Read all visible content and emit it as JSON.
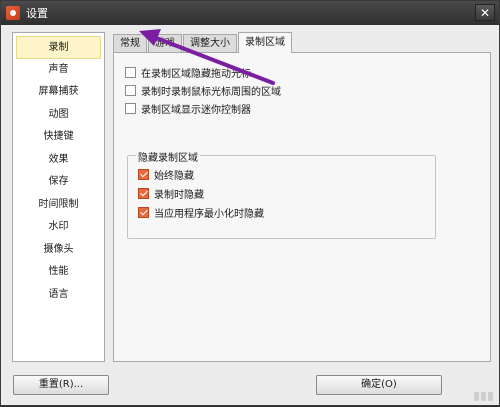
{
  "window": {
    "title": "设置",
    "close_glyph": "✕"
  },
  "sidebar": {
    "items": [
      {
        "label": "录制"
      },
      {
        "label": "声音"
      },
      {
        "label": "屏幕捕获"
      },
      {
        "label": "动图"
      },
      {
        "label": "快捷键"
      },
      {
        "label": "效果"
      },
      {
        "label": "保存"
      },
      {
        "label": "时间限制"
      },
      {
        "label": "水印"
      },
      {
        "label": "摄像头"
      },
      {
        "label": "性能"
      },
      {
        "label": "语言"
      }
    ],
    "active_index": 0
  },
  "tabs": [
    {
      "label": "常规"
    },
    {
      "label": "游戏"
    },
    {
      "label": "调整大小"
    },
    {
      "label": "录制区域"
    }
  ],
  "active_tab": 3,
  "options": [
    {
      "label": "在录制区域隐藏拖动光标",
      "checked": false
    },
    {
      "label": "录制时录制鼠标光标周围的区域",
      "checked": false
    },
    {
      "label": "录制区域显示迷你控制器",
      "checked": false
    }
  ],
  "hide_group": {
    "title": "隐藏录制区域",
    "options": [
      {
        "label": "始终隐藏",
        "checked": true
      },
      {
        "label": "录制时隐藏",
        "checked": true
      },
      {
        "label": "当应用程序最小化时隐藏",
        "checked": true
      }
    ]
  },
  "footer": {
    "reset_label": "重置(R)...",
    "ok_label": "确定(O)"
  },
  "colors": {
    "checkbox_accent": "#e8693e",
    "arrow": "#7b1fa2",
    "active_item_bg": "#fdf4c9"
  }
}
